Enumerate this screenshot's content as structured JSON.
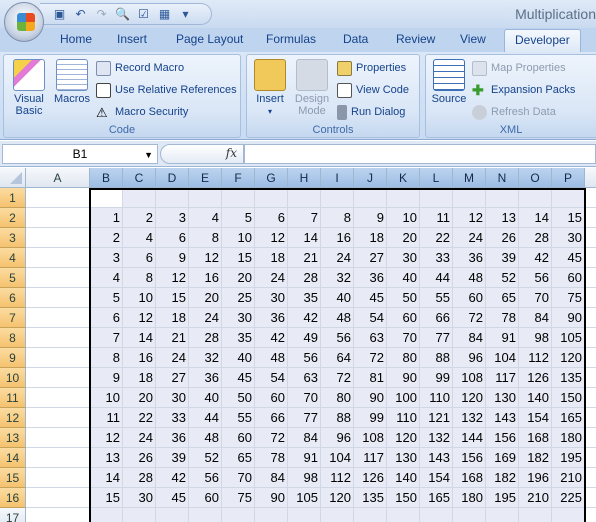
{
  "title": "Multiplication",
  "qat": {
    "icons": [
      "save-icon",
      "undo-icon",
      "redo-icon",
      "print-preview-icon",
      "spelling-icon",
      "form-icon",
      "customize-icon"
    ]
  },
  "tabs": [
    "Home",
    "Insert",
    "Page Layout",
    "Formulas",
    "Data",
    "Review",
    "View",
    "Developer"
  ],
  "active_tab": "Developer",
  "ribbon": {
    "code": {
      "label": "Code",
      "visual_basic": "Visual Basic",
      "macros": "Macros",
      "record_macro": "Record Macro",
      "relative_refs": "Use Relative References",
      "macro_security": "Macro Security"
    },
    "controls": {
      "label": "Controls",
      "insert": "Insert",
      "design_mode": "Design Mode",
      "properties": "Properties",
      "view_code": "View Code",
      "run_dialog": "Run Dialog"
    },
    "xml": {
      "label": "XML",
      "source": "Source",
      "map_properties": "Map Properties",
      "expansion_packs": "Expansion Packs",
      "refresh_data": "Refresh Data"
    }
  },
  "formula_bar": {
    "name_box": "B1",
    "fx": "fx",
    "formula": ""
  },
  "columns": [
    "A",
    "B",
    "C",
    "D",
    "E",
    "F",
    "G",
    "H",
    "I",
    "J",
    "K",
    "L",
    "M",
    "N",
    "O",
    "P",
    ""
  ],
  "rows": [
    "1",
    "2",
    "3",
    "4",
    "5",
    "6",
    "7",
    "8",
    "9",
    "10",
    "11",
    "12",
    "13",
    "14",
    "15",
    "16",
    "17"
  ],
  "table": [
    [
      1,
      2,
      3,
      4,
      5,
      6,
      7,
      8,
      9,
      10,
      11,
      12,
      13,
      14,
      15
    ],
    [
      2,
      4,
      6,
      8,
      10,
      12,
      14,
      16,
      18,
      20,
      22,
      24,
      26,
      28,
      30
    ],
    [
      3,
      6,
      9,
      12,
      15,
      18,
      21,
      24,
      27,
      30,
      33,
      36,
      39,
      42,
      45
    ],
    [
      4,
      8,
      12,
      16,
      20,
      24,
      28,
      32,
      36,
      40,
      44,
      48,
      52,
      56,
      60
    ],
    [
      5,
      10,
      15,
      20,
      25,
      30,
      35,
      40,
      45,
      50,
      55,
      60,
      65,
      70,
      75
    ],
    [
      6,
      12,
      18,
      24,
      30,
      36,
      42,
      48,
      54,
      60,
      66,
      72,
      78,
      84,
      90
    ],
    [
      7,
      14,
      21,
      28,
      35,
      42,
      49,
      56,
      63,
      70,
      77,
      84,
      91,
      98,
      105
    ],
    [
      8,
      16,
      24,
      32,
      40,
      48,
      56,
      64,
      72,
      80,
      88,
      96,
      104,
      112,
      120
    ],
    [
      9,
      18,
      27,
      36,
      45,
      54,
      63,
      72,
      81,
      90,
      99,
      108,
      117,
      126,
      135
    ],
    [
      10,
      20,
      30,
      40,
      50,
      60,
      70,
      80,
      90,
      100,
      110,
      120,
      130,
      140,
      150
    ],
    [
      11,
      22,
      33,
      44,
      55,
      66,
      77,
      88,
      99,
      110,
      121,
      132,
      143,
      154,
      165
    ],
    [
      12,
      24,
      36,
      48,
      60,
      72,
      84,
      96,
      108,
      120,
      132,
      144,
      156,
      168,
      180
    ],
    [
      13,
      26,
      39,
      52,
      65,
      78,
      91,
      104,
      117,
      130,
      143,
      156,
      169,
      182,
      195
    ],
    [
      14,
      28,
      42,
      56,
      70,
      84,
      98,
      112,
      126,
      140,
      154,
      168,
      182,
      196,
      210
    ],
    [
      15,
      30,
      45,
      60,
      75,
      90,
      105,
      120,
      135,
      150,
      165,
      180,
      195,
      210,
      225
    ]
  ],
  "colors": {
    "selection_fill": "#e8ebf5",
    "row_header_selected": "#f5c26e",
    "col_header_selected": "#9dbde4"
  }
}
